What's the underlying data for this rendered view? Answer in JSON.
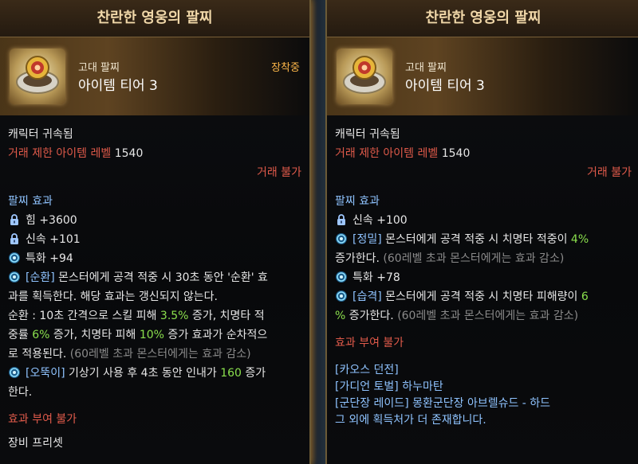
{
  "left": {
    "title": "찬란한 영웅의 팔찌",
    "grade": "고대 팔찌",
    "tier": "아이템 티어 3",
    "equipped": "장착중",
    "bound": "캐릭터 귀속됨",
    "trade_level_label": "거래 제한 아이템 레벨",
    "trade_level_value": "1540",
    "trade": "거래 불가",
    "effects_title": "팔찌 효과",
    "stats": [
      "힘 +3600",
      "신속 +101",
      "특화 +94"
    ],
    "effect1_tag": "[순환]",
    "effect1_line1": "몬스터에게 공격 적중 시 30초 동안 '순환' 효",
    "effect1_line2": "과를 획득한다. 해당 효과는 갱신되지 않는다.",
    "effect1_l3a": "순환 : 10초 간격으로 스킬 피해 ",
    "effect1_l3g": "3.5%",
    "effect1_l3b": " 증가, 치명타 적",
    "effect1_l4a": "중률 ",
    "effect1_l4g1": "6%",
    "effect1_l4b": " 증가, 치명타 피해 ",
    "effect1_l4g2": "10%",
    "effect1_l4c": " 증가 효과가 순차적으",
    "effect1_l5a": "로 적용된다. ",
    "effect1_l5grey": "(60레벨 초과 몬스터에게는 효과 감소)",
    "effect2_tag": "[오뚝이]",
    "effect2_a": " 기상기 사용 후 4초 동안 인내가 ",
    "effect2_g": "160",
    "effect2_b": " 증가",
    "effect2_line2": "한다.",
    "no_enchant": "효과 부여 불가",
    "next_cut": "장비 프리셋"
  },
  "right": {
    "title": "찬란한 영웅의 팔찌",
    "grade": "고대 팔찌",
    "tier": "아이템 티어 3",
    "bound": "캐릭터 귀속됨",
    "trade_level_label": "거래 제한 아이템 레벨",
    "trade_level_value": "1540",
    "trade": "거래 불가",
    "effects_title": "팔찌 효과",
    "stat1": "신속 +100",
    "effect1_tag": "[정밀]",
    "effect1_a": " 몬스터에게 공격 적중 시 치명타 적중이 ",
    "effect1_g": "4%",
    "effect1_line2a": "증가한다. ",
    "effect1_grey": "(60레벨 초과 몬스터에게는 효과 감소)",
    "stat2": "특화 +78",
    "effect2_tag": "[습격]",
    "effect2_a": " 몬스터에게 공격 적중 시 치명타 피해량이 ",
    "effect2_g1": "6",
    "effect2_g2": "%",
    "effect2_line2a": " 증가한다. ",
    "effect2_grey": "(60레벨 초과 몬스터에게는 효과 감소)",
    "no_enchant": "효과 부여 불가",
    "sources": [
      "[카오스 던전]",
      "[가디언 토벌] 하누마탄",
      "[군단장 레이드] 몽환군단장 아브렐슈드 - 하드",
      "그 외에 획득처가 더 존재합니다."
    ]
  },
  "colors": {
    "title": "#f0d7a8",
    "red": "#e05a4a",
    "blue": "#8fc3ff",
    "green": "#8adf4d",
    "equipped": "#ffb84a"
  },
  "icons": [
    "bracelet-icon",
    "lock-icon",
    "swirl-icon"
  ]
}
